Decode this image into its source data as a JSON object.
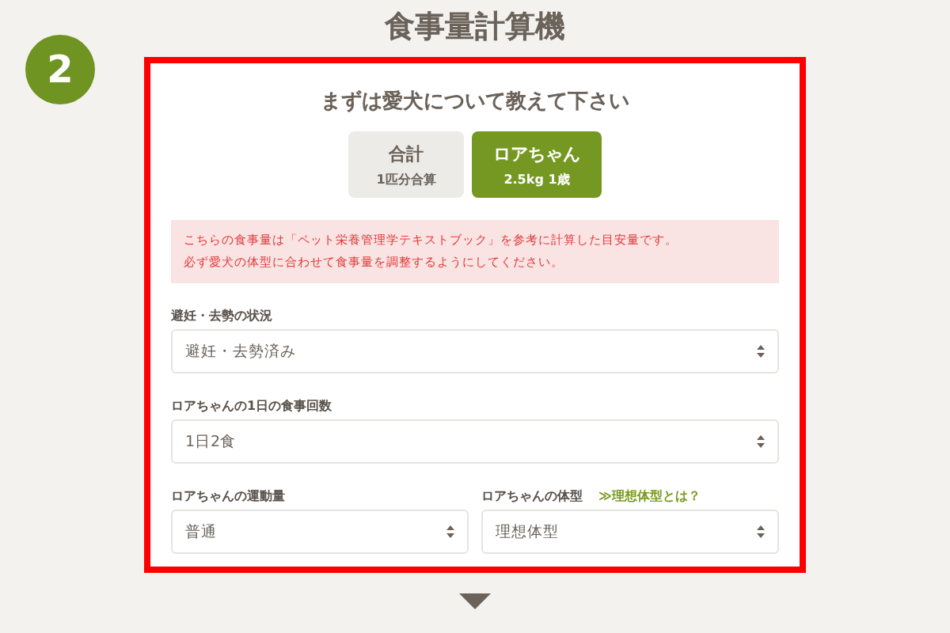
{
  "title": "食事量計算機",
  "step": "2",
  "card": {
    "heading": "まずは愛犬について教えて下さい",
    "tabs": [
      {
        "label": "合計",
        "sub": "1匹分合算",
        "selected": false
      },
      {
        "label": "ロアちゃん",
        "sub": "2.5kg 1歳",
        "selected": true
      }
    ],
    "notice": [
      "こちらの食事量は「ペット栄養管理学テキストブック」を参考に計算した目安量です。",
      "必ず愛犬の体型に合わせて食事量を調整するようにしてください。"
    ],
    "rows": [
      [
        {
          "label": "避妊・去勢の状況",
          "value": "避妊・去勢済み"
        }
      ],
      [
        {
          "label": "ロアちゃんの1日の食事回数",
          "value": "1日2食"
        }
      ],
      [
        {
          "label": "ロアちゃんの運動量",
          "value": "普通"
        },
        {
          "label": "ロアちゃんの体型",
          "link": "≫理想体型とは？",
          "value": "理想体型"
        }
      ]
    ]
  }
}
